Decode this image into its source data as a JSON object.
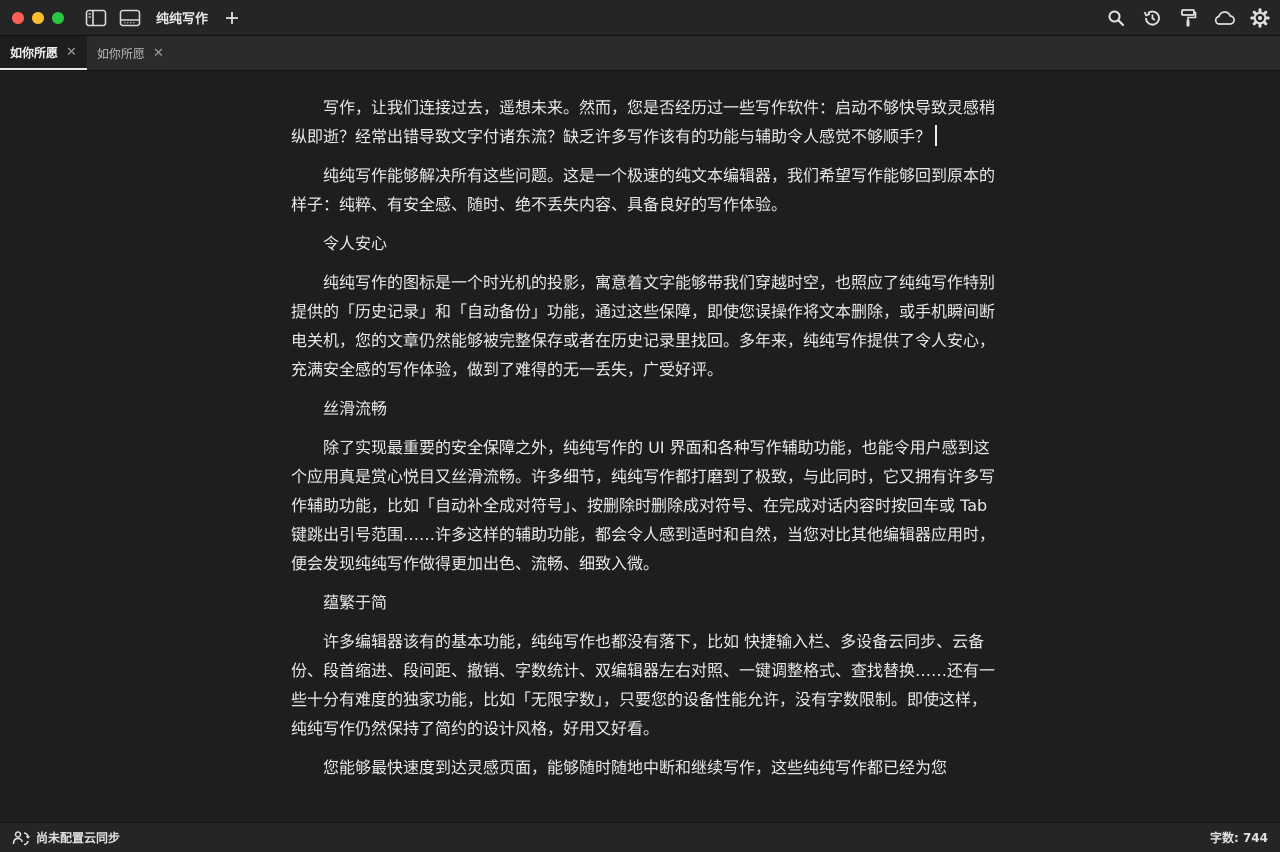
{
  "app": {
    "title": "纯纯写作"
  },
  "tabs": [
    {
      "label": "如你所愿",
      "active": true
    },
    {
      "label": "如你所愿",
      "active": false
    }
  ],
  "document": {
    "paragraphs": [
      "写作，让我们连接过去，遥想未来。然而，您是否经历过一些写作软件：启动不够快导致灵感稍纵即逝？经常出错导致文字付诸东流？缺乏许多写作该有的功能与辅助令人感觉不够顺手？",
      "纯纯写作能够解决所有这些问题。这是一个极速的纯文本编辑器，我们希望写作能够回到原本的样子：纯粹、有安全感、随时、绝不丢失内容、具备良好的写作体验。",
      "令人安心",
      "纯纯写作的图标是一个时光机的投影，寓意着文字能够带我们穿越时空，也照应了纯纯写作特别提供的「历史记录」和「自动备份」功能，通过这些保障，即使您误操作将文本删除，或手机瞬间断电关机，您的文章仍然能够被完整保存或者在历史记录里找回。多年来，纯纯写作提供了令人安心，充满安全感的写作体验，做到了难得的无一丢失，广受好评。",
      "丝滑流畅",
      "除了实现最重要的安全保障之外，纯纯写作的 UI 界面和各种写作辅助功能，也能令用户感到这个应用真是赏心悦目又丝滑流畅。许多细节，纯纯写作都打磨到了极致，与此同时，它又拥有许多写作辅助功能，比如「自动补全成对符号」、按删除时删除成对符号、在完成对话内容时按回车或 Tab 键跳出引号范围……许多这样的辅助功能，都会令人感到适时和自然，当您对比其他编辑器应用时，便会发现纯纯写作做得更加出色、流畅、细致入微。",
      "蕴繁于简",
      "许多编辑器该有的基本功能，纯纯写作也都没有落下，比如 快捷输入栏、多设备云同步、云备份、段首缩进、段间距、撤销、字数统计、双编辑器左右对照、一键调整格式、查找替换……还有一些十分有难度的独家功能，比如「无限字数」，只要您的设备性能允许，没有字数限制。即使这样，纯纯写作仍然保持了简约的设计风格，好用又好看。",
      "您能够最快速度到达灵感页面，能够随时随地中断和继续写作，这些纯纯写作都已经为您"
    ]
  },
  "status": {
    "sync_label": "尚未配置云同步",
    "word_count": "字数: 744"
  },
  "icons": {
    "sidebar": "sidebar-toggle-icon",
    "layout": "layout-icon",
    "add": "plus-icon",
    "search": "search-icon",
    "history": "history-icon",
    "format": "format-paint-icon",
    "cloud": "cloud-icon",
    "settings": "gear-icon"
  },
  "colors": {
    "background": "#1e1e1e",
    "titlebar": "#252525",
    "tabbar": "#2b2b2b",
    "text": "#e8e8e8",
    "close": "#ff5f57",
    "minimize": "#febc2e",
    "maximize": "#28c840"
  }
}
